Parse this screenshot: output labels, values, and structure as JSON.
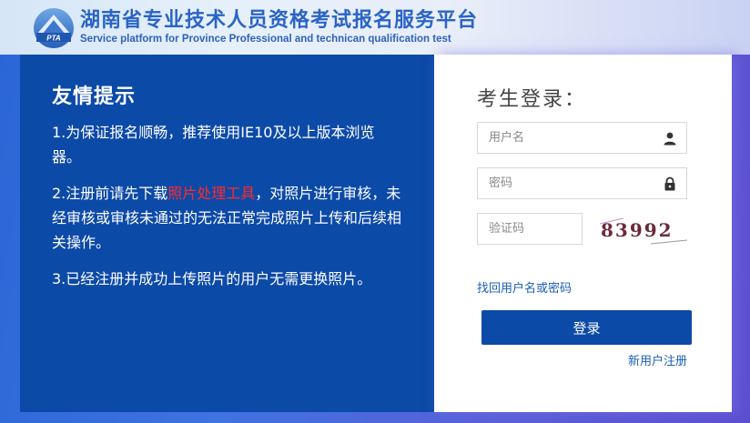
{
  "header": {
    "title_cn": "湖南省专业技术人员资格考试报名服务平台",
    "title_en": "Service platform for Province Professional and technican qualification test",
    "logo_text": "PTA"
  },
  "notice": {
    "title": "友情提示",
    "item1": "1.为保证报名顺畅，推荐使用IE10及以上版本浏览器。",
    "item2_before": "2.注册前请先下载",
    "item2_link": "照片处理工具",
    "item2_after": "，对照片进行审核，未经审核或审核未通过的无法正常完成照片上传和后续相关操作。",
    "item3": "3.已经注册并成功上传照片的用户无需更换照片。"
  },
  "login": {
    "title": "考生登录：",
    "username_placeholder": "用户名",
    "password_placeholder": "密码",
    "captcha_placeholder": "验证码",
    "captcha_text": "83992",
    "forgot_link": "找回用户名或密码",
    "submit_label": "登录",
    "register_link": "新用户注册"
  },
  "colors": {
    "primary": "#0c4aa8",
    "link": "#1a5fb5",
    "highlight": "#ff2a2a"
  },
  "icons": [
    "user-icon",
    "lock-icon",
    "pta-logo-icon"
  ]
}
